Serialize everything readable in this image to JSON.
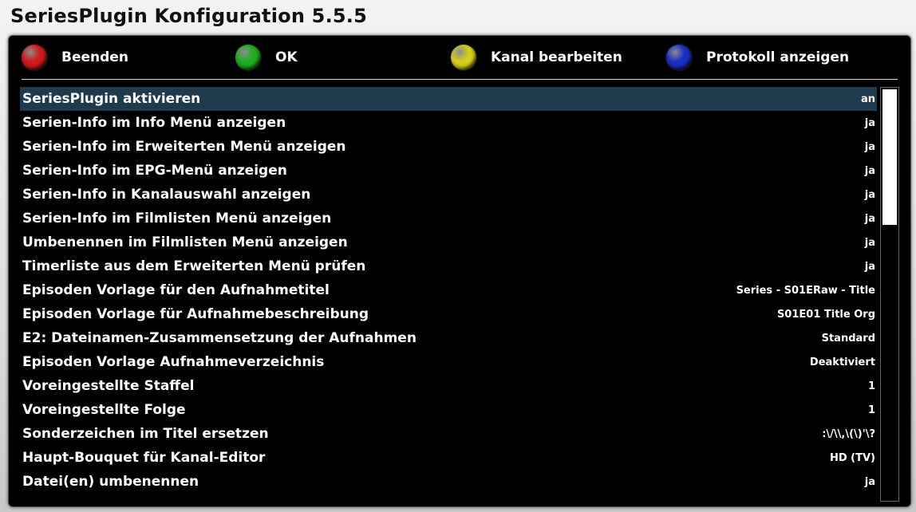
{
  "window": {
    "title": "SeriesPlugin Konfiguration 5.5.5"
  },
  "buttons": [
    {
      "label": "Beenden",
      "color": "#d11a1a",
      "icon": "red-button-icon"
    },
    {
      "label": "OK",
      "color": "#1fae1f",
      "icon": "green-button-icon"
    },
    {
      "label": "Kanal bearbeiten",
      "color": "#d6cf1c",
      "icon": "yellow-button-icon"
    },
    {
      "label": "Protokoll anzeigen",
      "color": "#1a2fc9",
      "icon": "blue-button-icon"
    }
  ],
  "config": {
    "selected_index": 0,
    "items": [
      {
        "label": "SeriesPlugin aktivieren",
        "value": "an"
      },
      {
        "label": "Serien-Info im Info Menü anzeigen",
        "value": "ja"
      },
      {
        "label": "Serien-Info im Erweiterten Menü anzeigen",
        "value": "ja"
      },
      {
        "label": "Serien-Info im EPG-Menü anzeigen",
        "value": "ja"
      },
      {
        "label": "Serien-Info in Kanalauswahl anzeigen",
        "value": "ja"
      },
      {
        "label": "Serien-Info im Filmlisten Menü anzeigen",
        "value": "ja"
      },
      {
        "label": "Umbenennen im Filmlisten Menü anzeigen",
        "value": "ja"
      },
      {
        "label": "Timerliste aus  dem Erweiterten Menü prüfen",
        "value": "ja"
      },
      {
        "label": "Episoden Vorlage für den Aufnahmetitel",
        "value": "Series - S01ERaw - Title"
      },
      {
        "label": "Episoden Vorlage für Aufnahmebeschreibung",
        "value": "S01E01 Title Org"
      },
      {
        "label": "E2: Dateinamen-Zusammensetzung der Aufnahmen",
        "value": "Standard"
      },
      {
        "label": "Episoden Vorlage Aufnahmeverzeichnis",
        "value": "Deaktiviert"
      },
      {
        "label": "Voreingestellte Staffel",
        "value": "1"
      },
      {
        "label": "Voreingestellte Folge",
        "value": "1"
      },
      {
        "label": "Sonderzeichen im Titel ersetzen",
        "value": ":\\/\\\\,\\(\\)'\\?"
      },
      {
        "label": "Haupt-Bouquet für Kanal-Editor",
        "value": "HD (TV)"
      },
      {
        "label": "Datei(en) umbenennen",
        "value": "ja"
      }
    ]
  },
  "scrollbar": {
    "visible_fraction": 0.33
  }
}
